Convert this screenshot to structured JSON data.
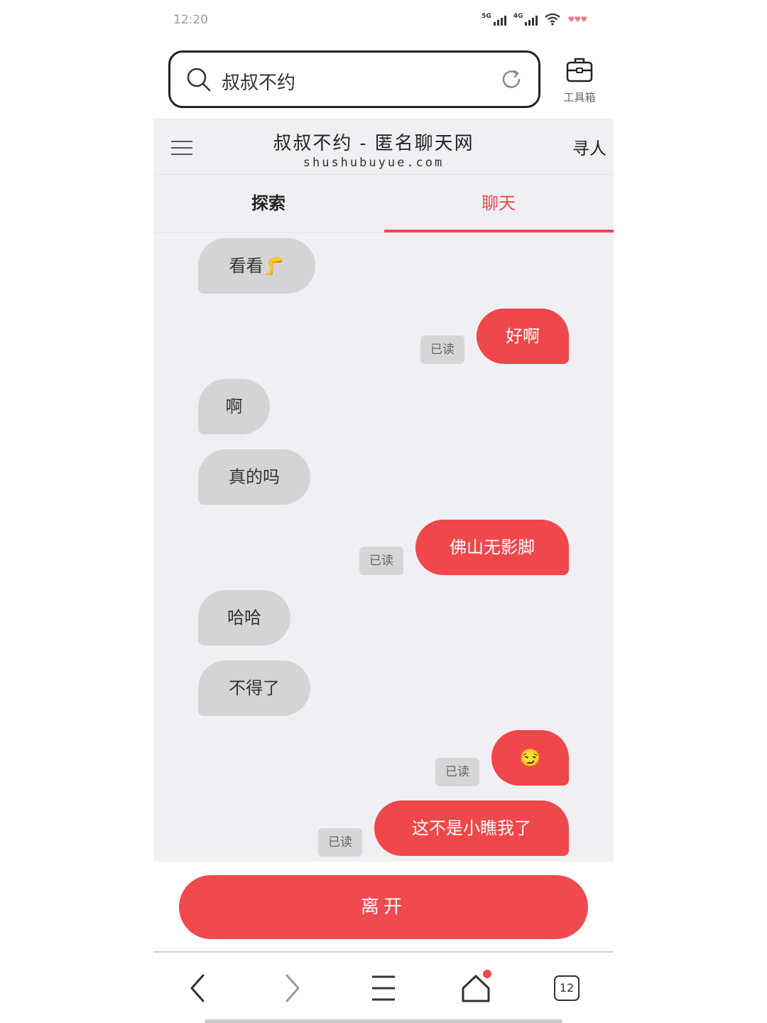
{
  "status_bar": {
    "time": "12:20",
    "signal_1": "5G",
    "signal_2": "4G",
    "battery_icon": "hearts-battery-icon"
  },
  "browser": {
    "address_text": "叔叔不约",
    "toolbox_label": "工具箱"
  },
  "site": {
    "title": "叔叔不约 - 匿名聊天网",
    "domain": "shushubuyue.com",
    "find_people": "寻人"
  },
  "tabs": [
    {
      "label": "探索"
    },
    {
      "label": "聊天"
    }
  ],
  "messages": [
    {
      "side": "in",
      "text": "看看🦵"
    },
    {
      "side": "out",
      "text": "好啊",
      "status": "已读"
    },
    {
      "side": "in",
      "text": "啊"
    },
    {
      "side": "in",
      "text": "真的吗"
    },
    {
      "side": "out",
      "text": "佛山无影脚",
      "status": "已读"
    },
    {
      "side": "in",
      "text": "哈哈"
    },
    {
      "side": "in",
      "text": "不得了"
    },
    {
      "side": "out",
      "text": "😏",
      "status": "已读"
    },
    {
      "side": "out",
      "text": "这不是小瞧我了",
      "status": "已读"
    }
  ],
  "leave_button": "离开",
  "bottom_nav": {
    "tab_count": "12"
  },
  "colors": {
    "accent": "#f0474b",
    "incoming_bubble": "#d4d4d6",
    "chat_background": "#f0eff3"
  }
}
